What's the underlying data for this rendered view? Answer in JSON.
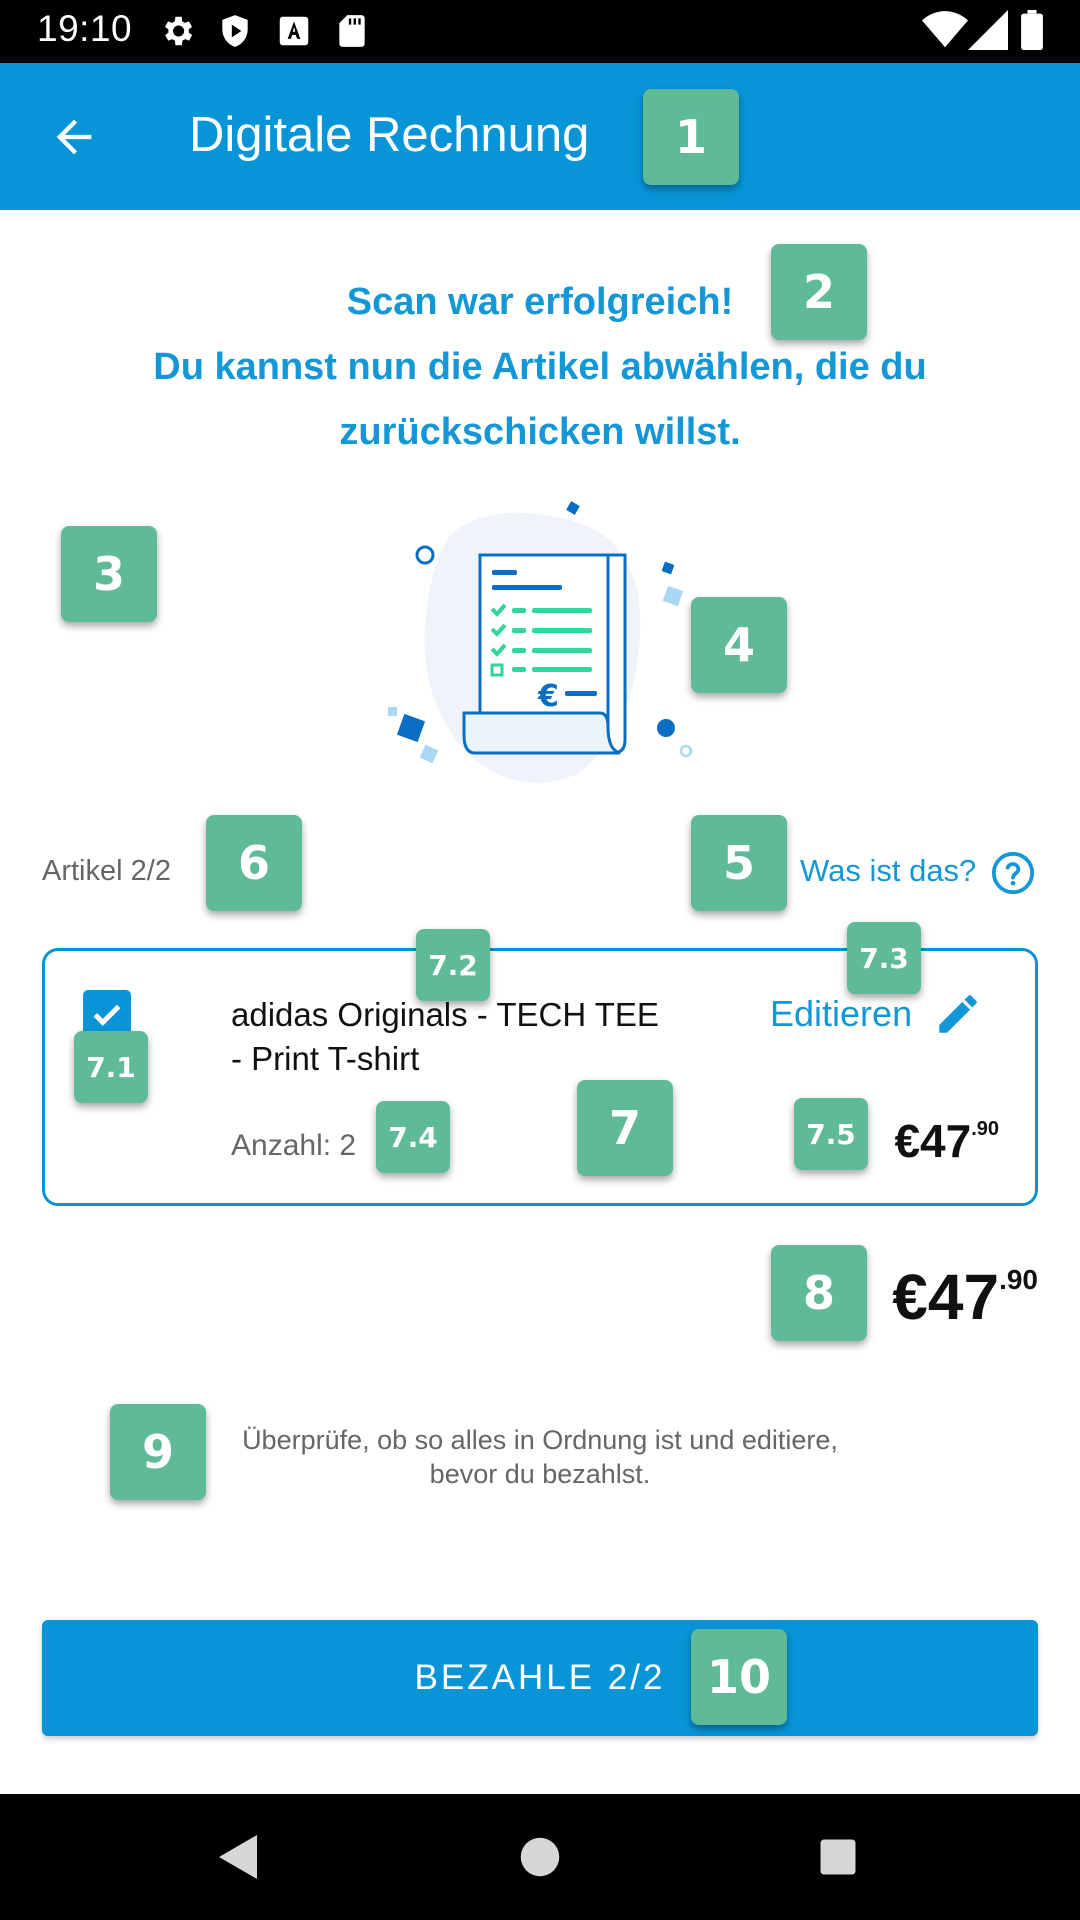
{
  "status_bar": {
    "time": "19:10",
    "left_icons": [
      "gear-icon",
      "shield-icon",
      "font-a-icon",
      "sd-card-icon"
    ],
    "right_icons": [
      "wifi-icon",
      "signal-icon",
      "battery-icon"
    ]
  },
  "app_bar": {
    "title": "Digitale Rechnung",
    "back_icon": "arrow-left-icon"
  },
  "headline": {
    "line1": "Scan war erfolgreich!",
    "line2": "Du kannst nun die Artikel abwählen, die du",
    "line3": "zurückschicken willst."
  },
  "illustration": {
    "icon": "receipt-checklist-icon",
    "currency_symbol": "€"
  },
  "articles": {
    "count_label": "Artikel 2/2",
    "help_link": "Was ist das?",
    "help_icon": "question-circle-icon"
  },
  "item": {
    "checked": true,
    "name_line1": "adidas Originals - TECH TEE",
    "name_line2": "- Print T-shirt",
    "edit_label": "Editieren",
    "edit_icon": "pencil-icon",
    "quantity": "Anzahl: 2",
    "price_main": "€47",
    "price_cents": ".90"
  },
  "total": {
    "main": "€47",
    "cents": ".90"
  },
  "hint": {
    "line1": "Überprüfe, ob so alles in Ordnung ist und editiere,",
    "line2": "bevor du bezahlst."
  },
  "pay_button": {
    "label": "BEZAHLE 2/2"
  },
  "annotations": {
    "b1": "1",
    "b2": "2",
    "b3": "3",
    "b4": "4",
    "b5": "5",
    "b6": "6",
    "b7": "7",
    "b71": "7.1",
    "b72": "7.2",
    "b73": "7.3",
    "b74": "7.4",
    "b75": "7.5",
    "b8": "8",
    "b9": "9",
    "b10": "10"
  },
  "nav_bar": {
    "icons": [
      "back-triangle-icon",
      "home-circle-icon",
      "recents-square-icon"
    ]
  },
  "colors": {
    "primary": "#0895d8",
    "text_blue": "#1497d6",
    "badge_green": "#5fba98",
    "illustration_green": "#2fd6a0"
  }
}
